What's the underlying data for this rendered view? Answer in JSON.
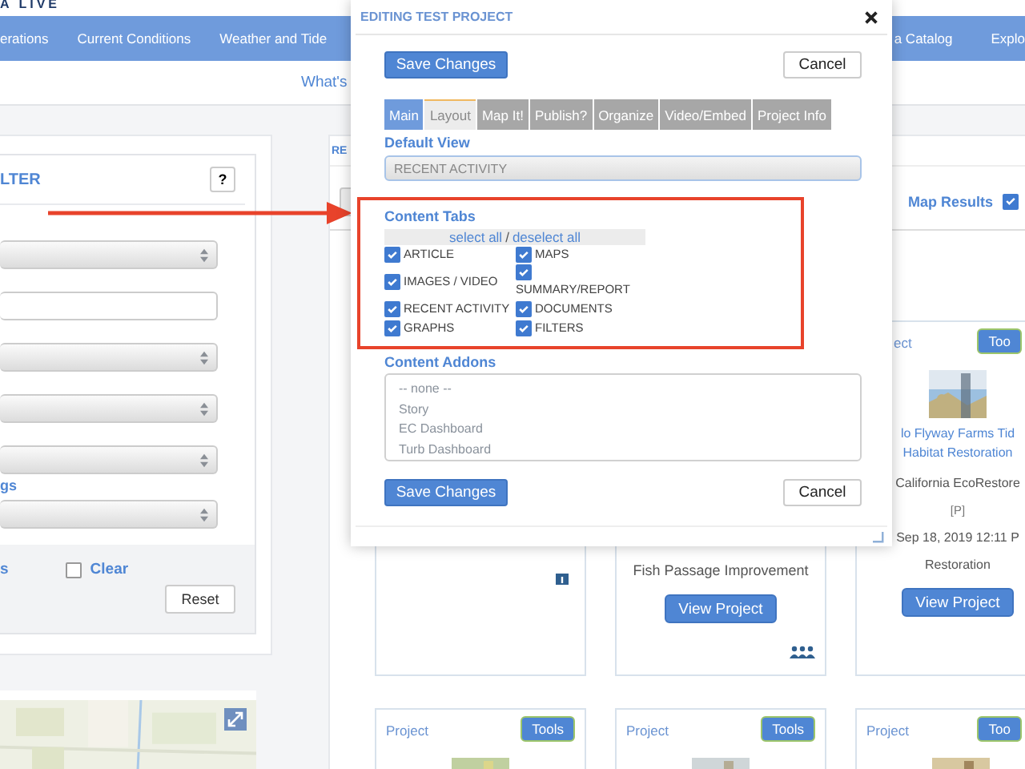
{
  "header": {
    "logo": "A LIVE"
  },
  "nav": {
    "items": [
      "erations",
      "Current Conditions",
      "Weather and Tide",
      "a Catalog",
      "Explo"
    ]
  },
  "subnav": {
    "link": "What's"
  },
  "filter_panel": {
    "title": "LTER",
    "help": "?",
    "fields": [
      {
        "kind": "select"
      },
      {
        "kind": "input"
      },
      {
        "kind": "select"
      },
      {
        "kind": "select"
      },
      {
        "kind": "select"
      },
      {
        "kind": "label",
        "text": "gs"
      },
      {
        "kind": "select"
      }
    ],
    "footer_link": "s",
    "clear": {
      "label": "Clear",
      "checked": false
    },
    "reset": "Reset"
  },
  "results": {
    "title": "RE",
    "map_results": {
      "label": "Map Results",
      "checked": true
    },
    "cards": [
      {
        "badge_icon": true
      },
      {
        "category": "Fish Passage Improvement",
        "button": "View Project",
        "members_icon": true
      },
      {
        "label": "ect",
        "tools": "Too",
        "image": true,
        "title": [
          "lo Flyway Farms Tid",
          "Habitat Restoration"
        ],
        "org": "California EcoRestore",
        "tag": "[P]",
        "date": "Sep 18, 2019 12:11 P",
        "category": "Restoration",
        "button": "View Project"
      },
      {
        "label": "Project",
        "tools": "Tools",
        "image": true
      },
      {
        "label": "Project",
        "tools": "Tools",
        "image": true
      },
      {
        "label": "Project",
        "tools": "Too",
        "image": true
      }
    ]
  },
  "modal": {
    "title": "EDITING TEST PROJECT",
    "save": "Save Changes",
    "cancel": "Cancel",
    "tabs": [
      {
        "label": "Main",
        "selected": false,
        "highlighted": true
      },
      {
        "label": "Layout",
        "selected": true,
        "highlighted": false
      },
      {
        "label": "Map It!",
        "selected": false,
        "highlighted": false
      },
      {
        "label": "Publish?",
        "selected": false,
        "highlighted": false
      },
      {
        "label": "Organize",
        "selected": false,
        "highlighted": false
      },
      {
        "label": "Video/Embed",
        "selected": false,
        "highlighted": false
      },
      {
        "label": "Project Info",
        "selected": false,
        "highlighted": false
      }
    ],
    "default_view": {
      "label": "Default View",
      "value": "RECENT ACTIVITY"
    },
    "content_tabs": {
      "label": "Content Tabs",
      "select_all": "select all",
      "separator": "/",
      "deselect_all": "deselect all",
      "options": [
        {
          "label": "ARTICLE",
          "checked": true
        },
        {
          "label": "MAPS",
          "checked": true
        },
        {
          "label": "IMAGES / VIDEO",
          "checked": true
        },
        {
          "label": "SUMMARY/REPORT",
          "checked": true
        },
        {
          "label": "RECENT ACTIVITY",
          "checked": true
        },
        {
          "label": "DOCUMENTS",
          "checked": true
        },
        {
          "label": "GRAPHS",
          "checked": true
        },
        {
          "label": "FILTERS",
          "checked": true
        }
      ]
    },
    "addons": {
      "label": "Content Addons",
      "options": [
        "-- none --",
        "Story",
        "EC Dashboard",
        "Turb Dashboard"
      ]
    },
    "bottom_save": "Save Changes",
    "bottom_cancel": "Cancel"
  }
}
